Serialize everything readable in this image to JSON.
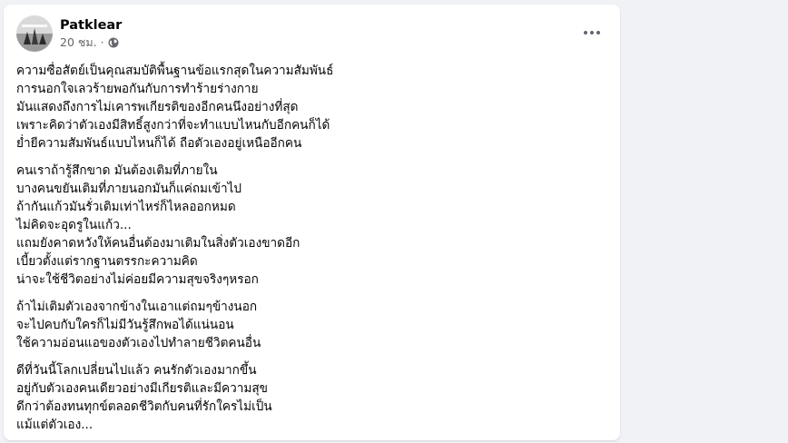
{
  "post": {
    "author": "Patklear",
    "time": "20 ชม.",
    "separator": "·",
    "privacy_icon": "globe-icon",
    "paragraphs": [
      [
        "ความซื่อสัตย์เป็นคุณสมบัติพื้นฐานข้อแรกสุดในความสัมพันธ์",
        "การนอกใจเลวร้ายพอกันกับการทำร้ายร่างกาย",
        "มันแสดงถึงการไม่เคารพเกียรติของอีกคนนึงอย่างที่สุด",
        "เพราะคิดว่าตัวเองมีสิทธิ์สูงกว่าที่จะทำแบบไหนกับอีกคนก็ได้",
        "ย่ำยีความสัมพันธ์แบบไหนก็ได้ ถือตัวเองอยู่เหนืออีกคน"
      ],
      [
        "คนเราถ้ารู้สึกขาด มันต้องเติมที่ภายใน",
        "บางคนขยันเติมที่ภายนอกมันก็แค่ถมเข้าไป",
        "ถ้ากันแก้วมันรั่วเติมเท่าไหร่ก็ไหลออกหมด",
        "ไม่คิดจะอุดรูในแก้ว...",
        "แถมยังคาดหวังให้คนอื่นต้องมาเติมในสิ่งตัวเองขาดอีก",
        "เบี้ยวตั้งแต่รากฐานตรรกะความคิด",
        "น่าจะใช้ชีวิตอย่างไม่ค่อยมีความสุขจริงๆหรอก"
      ],
      [
        "ถ้าไม่เติมตัวเองจากข้างในเอาแต่ถมๆข้างนอก",
        "จะไปคบกับใครก็ไม่มีวันรู้สึกพอได้แน่นอน",
        "ใช้ความอ่อนแอของตัวเองไปทำลายชีวิตคนอื่น"
      ],
      [
        "ดีที่วันนี้โลกเปลี่ยนไปแล้ว คนรักตัวเองมากขึ้น",
        "อยู่กับตัวเองคนเดียวอย่างมีเกียรติและมีความสุข",
        "ดีกว่าต้องทนทุกข์ตลอดชีวิตกับคนที่รักใครไม่เป็น",
        "แม้แต่ตัวเอง..."
      ]
    ]
  },
  "colors": {
    "background": "#f0f2f5",
    "card": "#ffffff",
    "text": "#050505",
    "secondary_text": "#65676b"
  }
}
